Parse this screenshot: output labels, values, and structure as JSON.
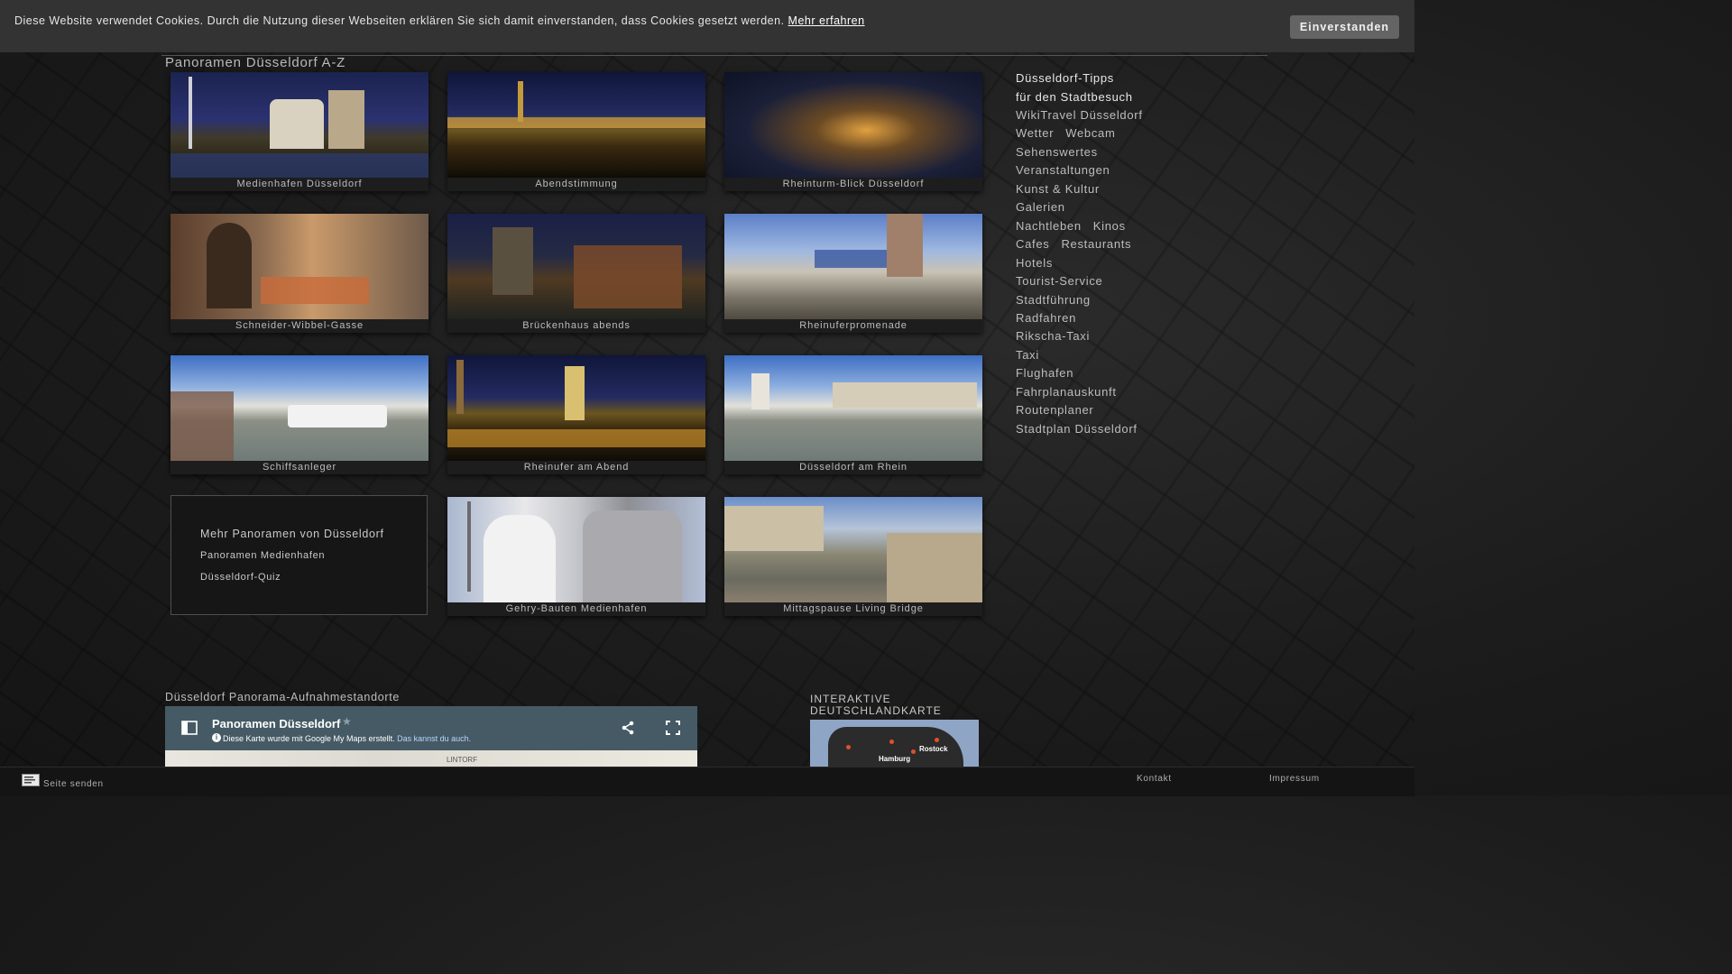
{
  "cookie": {
    "message": "Diese Website verwendet Cookies. Durch die Nutzung dieser Webseiten erklären Sie sich damit einverstanden, dass Cookies gesetzt werden.",
    "link": "Mehr erfahren",
    "button": "Einverstanden"
  },
  "page_title": "Panoramen Düsseldorf A-Z",
  "tiles": [
    {
      "caption": "Medienhafen Düsseldorf"
    },
    {
      "caption": "Abendstimmung"
    },
    {
      "caption": "Rheinturm-Blick Düsseldorf"
    },
    {
      "caption": "Schneider-Wibbel-Gasse"
    },
    {
      "caption": "Brückenhaus abends"
    },
    {
      "caption": "Rheinuferpromenade"
    },
    {
      "caption": "Schiffsanleger"
    },
    {
      "caption": "Rheinufer am Abend"
    },
    {
      "caption": "Düsseldorf am Rhein"
    },
    {
      "caption": "Gehry-Bauten Medienhafen"
    },
    {
      "caption": "Mittagspause Living Bridge"
    }
  ],
  "more": {
    "heading": "Mehr Panoramen von Düsseldorf",
    "link1": "Panoramen Medienhafen",
    "link2": "Düsseldorf-Quiz"
  },
  "sidebar": {
    "heading1": "Düsseldorf-Tipps",
    "heading2": "für den Stadtbesuch",
    "rows": [
      [
        "WikiTravel Düsseldorf"
      ],
      [
        "Wetter",
        "Webcam"
      ],
      [
        "Sehenswertes"
      ],
      [
        "Veranstaltungen"
      ],
      [
        "Kunst & Kultur"
      ],
      [
        "Galerien"
      ],
      [
        "Nachtleben",
        "Kinos"
      ],
      [
        "Cafes",
        "Restaurants"
      ],
      [
        "Hotels"
      ],
      [
        "Tourist-Service"
      ],
      [
        "Stadtführung"
      ],
      [
        "Radfahren"
      ],
      [
        "Rikscha-Taxi"
      ],
      [
        "Taxi"
      ],
      [
        "Flughafen"
      ],
      [
        "Fahrplanauskunft"
      ],
      [
        "Routenplaner"
      ],
      [
        "Stadtplan Düsseldorf"
      ]
    ]
  },
  "map_section": {
    "title": "Düsseldorf Panorama-Aufnahmestandorte",
    "map_title": "Panoramen Düsseldorf",
    "map_sub": "Diese Karte wurde mit Google My Maps erstellt.",
    "map_sub_link": "Das kannst du auch.",
    "map_label": "LINTORF"
  },
  "germany_map": {
    "title": "INTERAKTIVE DEUTSCHLANDKARTE",
    "city1": "Rostock",
    "city2": "Hamburg"
  },
  "footer": {
    "send": "Seite senden",
    "kontakt": "Kontakt",
    "impressum": "Impressum"
  },
  "colors": {
    "cookie_bar": "#333333",
    "button": "#646464",
    "map_header": "#455a64"
  }
}
